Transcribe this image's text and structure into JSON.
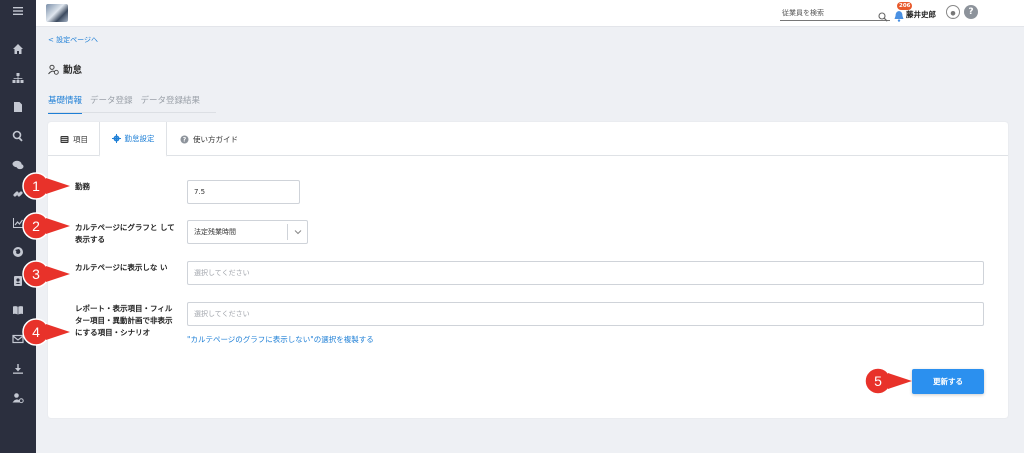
{
  "sidebar": {
    "items": [
      {
        "icon": "menu-icon"
      },
      {
        "icon": "home-icon"
      },
      {
        "icon": "org-chart-icon"
      },
      {
        "icon": "document-icon"
      },
      {
        "icon": "search-icon"
      },
      {
        "icon": "chat-icon"
      },
      {
        "icon": "link-icon"
      },
      {
        "icon": "chart-icon"
      },
      {
        "icon": "globe-icon"
      },
      {
        "icon": "contact-book-icon"
      },
      {
        "icon": "book-icon"
      },
      {
        "icon": "mail-icon"
      },
      {
        "icon": "download-icon"
      },
      {
        "icon": "user-settings-icon"
      }
    ]
  },
  "header": {
    "search_placeholder": "従業員を検索",
    "notification_count": "206",
    "username": "藤井史郎",
    "help_label": "?"
  },
  "breadcrumb": {
    "back_label": "< 設定ページへ"
  },
  "page": {
    "title": "勤怠"
  },
  "main_tabs": [
    {
      "label": "基礎情報",
      "active": true
    },
    {
      "label": "データ登録",
      "active": false
    },
    {
      "label": "データ登録結果",
      "active": false
    }
  ],
  "card_tabs": [
    {
      "label": "項目",
      "active": false
    },
    {
      "label": "勤怠設定",
      "active": true
    },
    {
      "label": "使い方ガイド",
      "active": false
    }
  ],
  "form": {
    "work_label": "勤務",
    "work_value": "7.5",
    "graph_label": "カルテページにグラフと して表示する",
    "graph_value": "法定残業時間",
    "hide_label": "カルテページに表示しな い",
    "hide_placeholder": "選択してください",
    "report_label": "レポート・表示項目・フィルター項目・異動計画で非表示にする項目・シナリオ",
    "report_placeholder": "選択してください",
    "copy_link": "\"カルテページのグラフに表示しない\"の選択を複製する",
    "update_button": "更新する"
  },
  "callouts": [
    "1",
    "2",
    "3",
    "4",
    "5"
  ],
  "colors": {
    "sidebar_bg": "#2b2f3e",
    "accent": "#1e7fd6",
    "button": "#2b90ef",
    "callout": "#e8322a",
    "badge": "#e85a2c"
  }
}
